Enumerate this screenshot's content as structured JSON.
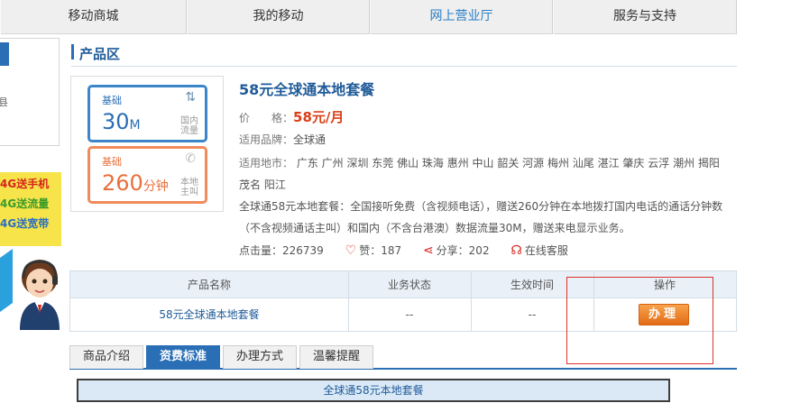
{
  "nav": {
    "items": [
      {
        "label": "移动商城"
      },
      {
        "label": "我的移动"
      },
      {
        "label": "网上营业厅"
      },
      {
        "label": "服务与支持"
      }
    ]
  },
  "sidebar": {
    "menu_fragment": "县",
    "promo_lines": [
      "4G送手机",
      "4G送流量",
      "4G送宽带"
    ]
  },
  "section": {
    "title": "产品区"
  },
  "cards": {
    "data": {
      "tag": "基础",
      "value": "30",
      "unit": "M",
      "desc": "国内流量",
      "icon": "data-transfer-icon"
    },
    "voice": {
      "tag": "基础",
      "value": "260",
      "unit": "分钟",
      "desc": "本地主叫",
      "icon": "phone-icon"
    }
  },
  "product": {
    "title": "58元全球通本地套餐",
    "price_label": "价　　格：",
    "price_value": "58元/月",
    "brand_label": "适用品牌：",
    "brand_value": "全球通",
    "region_label": "适用地市：",
    "region_value_line1": "广东 广州 深圳 东莞 佛山 珠海 惠州 中山 韶关 河源 梅州 汕尾 湛江 肇庆 云浮 潮州 揭阳",
    "region_value_line2": "茂名 阳江",
    "desc_line1": "全球通58元本地套餐：全国接听免费（含视频电话），赠送260分钟在本地拨打国内电话的通话分钟数",
    "desc_line2": "（不含视频通话主叫）和国内（不含台港澳）数据流量30M，赠送来电显示业务。",
    "clicks_label": "点击量：226739",
    "likes_label": "赞：187",
    "share_label": "分享：202",
    "support_label": "在线客服"
  },
  "table": {
    "headers": [
      "产品名称",
      "业务状态",
      "生效时间",
      "操作"
    ],
    "rows": [
      {
        "name": "58元全球通本地套餐",
        "status": "--",
        "effective": "--",
        "action": "办理"
      }
    ]
  },
  "tabs": [
    {
      "label": "商品介绍",
      "active": false
    },
    {
      "label": "资费标准",
      "active": true
    },
    {
      "label": "办理方式",
      "active": false
    },
    {
      "label": "温馨提醒",
      "active": false
    }
  ],
  "tab_content": {
    "title": "全球通58元本地套餐"
  },
  "colors": {
    "accent": "#2a6fb5",
    "price": "#d9401a",
    "button": "#e46c16",
    "highlight": "#d9342b"
  }
}
